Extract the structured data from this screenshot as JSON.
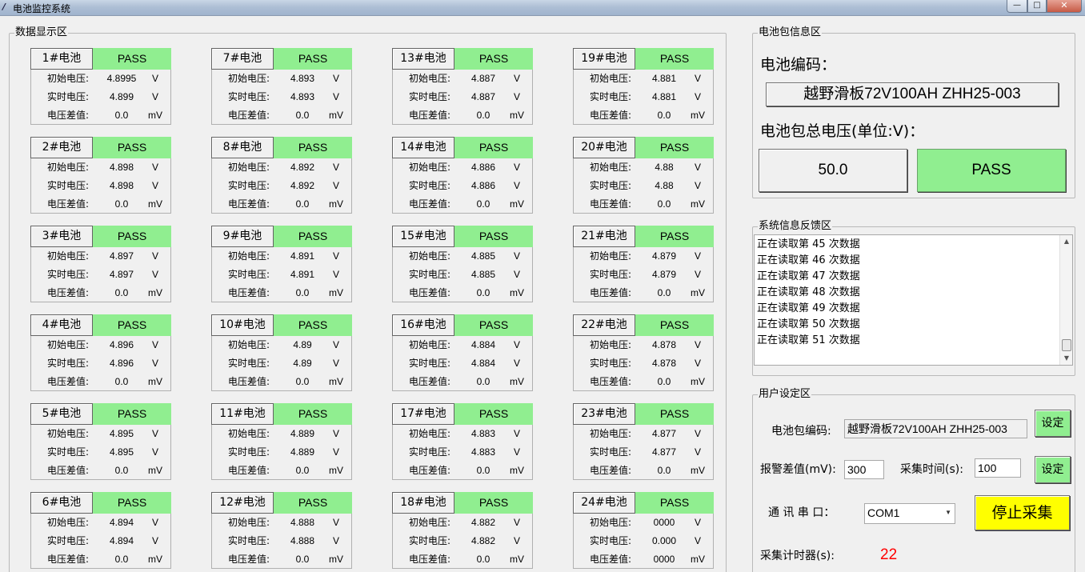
{
  "window": {
    "title": "电池监控系统",
    "min_glyph": "—",
    "max_glyph": "□",
    "close_glyph": "✕"
  },
  "data_area": {
    "title": "数据显示区",
    "label_initial": "初始电压:",
    "label_realtime": "实时电压:",
    "label_diff": "电压差值:",
    "unit_v": "V",
    "unit_mv": "mV",
    "cells": [
      {
        "id": "1#电池",
        "status": "PASS",
        "initial": "4.8995",
        "realtime": "4.899",
        "diff": "0.0"
      },
      {
        "id": "2#电池",
        "status": "PASS",
        "initial": "4.898",
        "realtime": "4.898",
        "diff": "0.0"
      },
      {
        "id": "3#电池",
        "status": "PASS",
        "initial": "4.897",
        "realtime": "4.897",
        "diff": "0.0"
      },
      {
        "id": "4#电池",
        "status": "PASS",
        "initial": "4.896",
        "realtime": "4.896",
        "diff": "0.0"
      },
      {
        "id": "5#电池",
        "status": "PASS",
        "initial": "4.895",
        "realtime": "4.895",
        "diff": "0.0"
      },
      {
        "id": "6#电池",
        "status": "PASS",
        "initial": "4.894",
        "realtime": "4.894",
        "diff": "0.0"
      },
      {
        "id": "7#电池",
        "status": "PASS",
        "initial": "4.893",
        "realtime": "4.893",
        "diff": "0.0"
      },
      {
        "id": "8#电池",
        "status": "PASS",
        "initial": "4.892",
        "realtime": "4.892",
        "diff": "0.0"
      },
      {
        "id": "9#电池",
        "status": "PASS",
        "initial": "4.891",
        "realtime": "4.891",
        "diff": "0.0"
      },
      {
        "id": "10#电池",
        "status": "PASS",
        "initial": "4.89",
        "realtime": "4.89",
        "diff": "0.0"
      },
      {
        "id": "11#电池",
        "status": "PASS",
        "initial": "4.889",
        "realtime": "4.889",
        "diff": "0.0"
      },
      {
        "id": "12#电池",
        "status": "PASS",
        "initial": "4.888",
        "realtime": "4.888",
        "diff": "0.0"
      },
      {
        "id": "13#电池",
        "status": "PASS",
        "initial": "4.887",
        "realtime": "4.887",
        "diff": "0.0"
      },
      {
        "id": "14#电池",
        "status": "PASS",
        "initial": "4.886",
        "realtime": "4.886",
        "diff": "0.0"
      },
      {
        "id": "15#电池",
        "status": "PASS",
        "initial": "4.885",
        "realtime": "4.885",
        "diff": "0.0"
      },
      {
        "id": "16#电池",
        "status": "PASS",
        "initial": "4.884",
        "realtime": "4.884",
        "diff": "0.0"
      },
      {
        "id": "17#电池",
        "status": "PASS",
        "initial": "4.883",
        "realtime": "4.883",
        "diff": "0.0"
      },
      {
        "id": "18#电池",
        "status": "PASS",
        "initial": "4.882",
        "realtime": "4.882",
        "diff": "0.0"
      },
      {
        "id": "19#电池",
        "status": "PASS",
        "initial": "4.881",
        "realtime": "4.881",
        "diff": "0.0"
      },
      {
        "id": "20#电池",
        "status": "PASS",
        "initial": "4.88",
        "realtime": "4.88",
        "diff": "0.0"
      },
      {
        "id": "21#电池",
        "status": "PASS",
        "initial": "4.879",
        "realtime": "4.879",
        "diff": "0.0"
      },
      {
        "id": "22#电池",
        "status": "PASS",
        "initial": "4.878",
        "realtime": "4.878",
        "diff": "0.0"
      },
      {
        "id": "23#电池",
        "status": "PASS",
        "initial": "4.877",
        "realtime": "4.877",
        "diff": "0.0"
      },
      {
        "id": "24#电池",
        "status": "PASS",
        "initial": "0000",
        "realtime": "0.000",
        "diff": "0000"
      }
    ]
  },
  "pack_info": {
    "title": "电池包信息区",
    "code_label": "电池编码：",
    "code_value": "越野滑板72V100AH ZHH25-003",
    "total_voltage_label": "电池包总电压(单位:V)：",
    "total_voltage_value": "50.0",
    "pack_status": "PASS"
  },
  "system_log": {
    "title": "系统信息反馈区",
    "lines": [
      "正在读取第 45 次数据",
      "正在读取第 46 次数据",
      "正在读取第 47 次数据",
      "正在读取第 48 次数据",
      "正在读取第 49 次数据",
      "正在读取第 50 次数据",
      "正在读取第 51 次数据"
    ]
  },
  "user_settings": {
    "title": "用户设定区",
    "pack_code_label": "电池包编码:",
    "pack_code_value": "越野滑板72V100AH ZHH25-003",
    "set_button_1": "设定",
    "alarm_diff_label": "报警差值(mV):",
    "alarm_diff_value": "300",
    "sample_time_label": "采集时间(s):",
    "sample_time_value": "100",
    "set_button_2": "设定",
    "port_label": "通 讯 串 口：",
    "port_value": "COM1",
    "stop_button": "停止采集",
    "timer_label": "采集计时器(s):",
    "timer_value": "22"
  },
  "colors": {
    "pass_green": "#90ee90",
    "stop_yellow": "#ffff00",
    "timer_red": "#ff0000",
    "background": "#f0f0f0"
  }
}
